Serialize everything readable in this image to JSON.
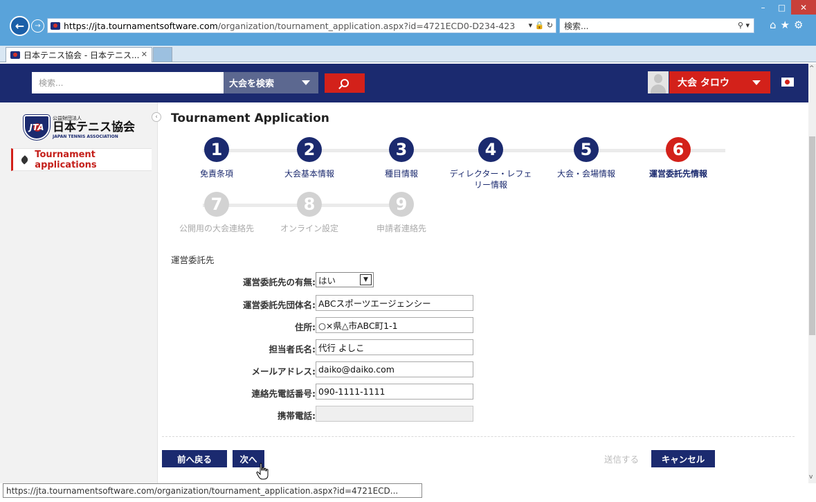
{
  "browser": {
    "url_host": "https://jta.tournamentsoftware.com",
    "url_path": "/organization/tournament_application.aspx?id=4721ECD0-D234-423",
    "search_placeholder": "検索...",
    "tab_title": "日本テニス協会 - 日本テニス...",
    "status_url": "https://jta.tournamentsoftware.com/organization/tournament_application.aspx?id=4721ECD..."
  },
  "header": {
    "search_placeholder": "検索...",
    "search_type": "大会を検索",
    "user_name": "大会 タロウ"
  },
  "sidebar": {
    "logo_small": "公益財団法人",
    "logo_main": "日本テニス協会",
    "logo_en": "JAPAN TENNIS ASSOCIATION",
    "logo_mark": "JTA",
    "items": [
      {
        "label": "Tournament applications"
      }
    ]
  },
  "page": {
    "title": "Tournament Application",
    "steps": [
      {
        "number": "1",
        "label": "免責条項"
      },
      {
        "number": "2",
        "label": "大会基本情報"
      },
      {
        "number": "3",
        "label": "種目情報"
      },
      {
        "number": "4",
        "label": "ディレクター・レフェリー情報"
      },
      {
        "number": "5",
        "label": "大会・会場情報"
      },
      {
        "number": "6",
        "label": "運営委託先情報"
      },
      {
        "number": "7",
        "label": "公開用の大会連絡先"
      },
      {
        "number": "8",
        "label": "オンライン設定"
      },
      {
        "number": "9",
        "label": "申請者連絡先"
      }
    ],
    "section_label": "運営委託先"
  },
  "form": {
    "has_contractor": {
      "label": "運営委託先の有無:",
      "value": "はい"
    },
    "org_name": {
      "label": "運営委託先団体名:",
      "value": "ABCスポーツエージェンシー"
    },
    "address": {
      "label": "住所:",
      "value": "○×県△市ABC町1-1"
    },
    "person": {
      "label": "担当者氏名:",
      "value": "代行 よしこ"
    },
    "email": {
      "label": "メールアドレス:",
      "value": "daiko@daiko.com"
    },
    "phone": {
      "label": "連絡先電話番号:",
      "value": "090-1111-1111"
    },
    "mobile": {
      "label": "携帯電話:",
      "value": ""
    }
  },
  "buttons": {
    "back": "前へ戻る",
    "next": "次へ",
    "submit": "送信する",
    "cancel": "キャンセル"
  },
  "colors": {
    "navy": "#1b2a6f",
    "red": "#d3211a",
    "titlebar": "#59a3da"
  }
}
